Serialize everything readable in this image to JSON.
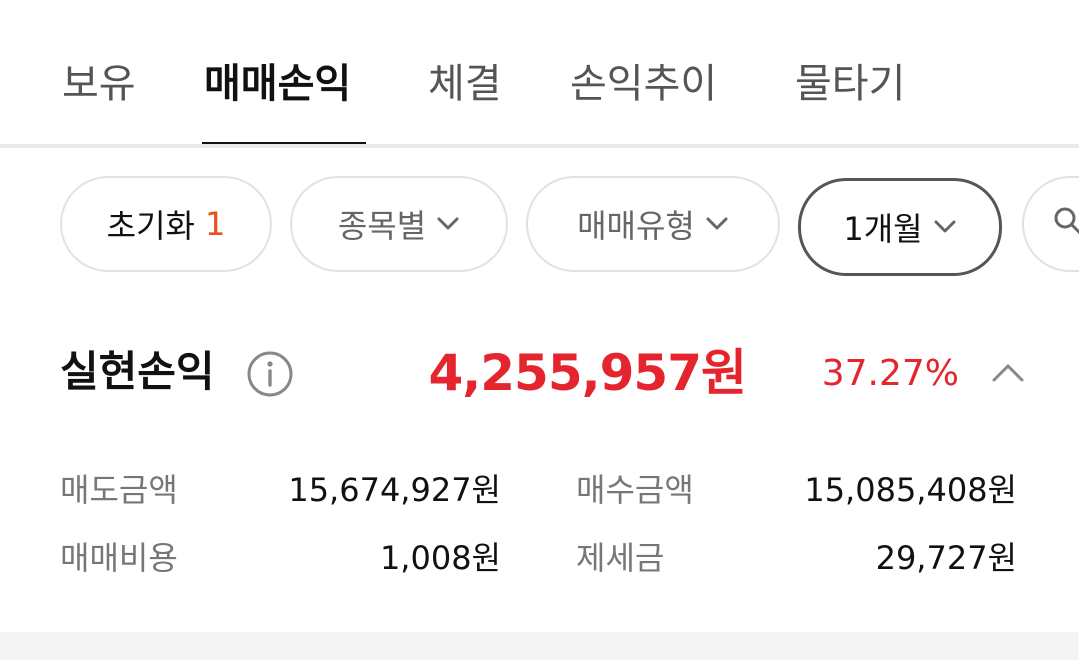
{
  "tabs": [
    {
      "label": "보유"
    },
    {
      "label": "매매손익"
    },
    {
      "label": "체결"
    },
    {
      "label": "손익추이"
    },
    {
      "label": "물타기"
    }
  ],
  "active_tab": "매매손익",
  "filters": {
    "reset_label": "초기화",
    "reset_count": "1",
    "by_stock": "종목별",
    "trade_type": "매매유형",
    "period": "1개월"
  },
  "icons": {
    "info": "info-icon",
    "chevron": "chevron-down-icon",
    "collapse": "chevron-up-icon",
    "search": "search-icon"
  },
  "summary": {
    "title": "실현손익",
    "amount": "4,255,957원",
    "rate": "37.27%"
  },
  "details": {
    "sell_amount_label": "매도금액",
    "sell_amount": "15,674,927원",
    "buy_amount_label": "매수금액",
    "buy_amount": "15,085,408원",
    "fee_label": "매매비용",
    "fee": "1,008원",
    "tax_label": "제세금",
    "tax": "29,727원"
  },
  "colors": {
    "profit": "#e5252e",
    "count_accent": "#e8501e"
  }
}
